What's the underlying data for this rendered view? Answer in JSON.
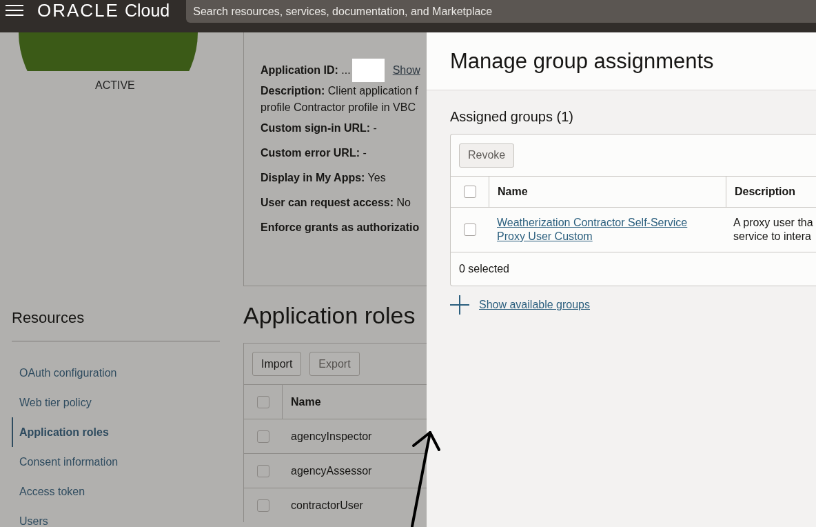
{
  "header": {
    "brand": "ORACLE",
    "product": "Cloud",
    "search_placeholder": "Search resources, services, documentation, and Marketplace"
  },
  "status": {
    "label": "ACTIVE"
  },
  "details": {
    "app_id_label": "Application ID:",
    "app_id_value": "...",
    "show_link": "Show",
    "fields": [
      {
        "text": "**Description:** Client application f\nprofile Contractor profile in VBC"
      },
      {
        "text": "**Custom sign-in URL:** -"
      },
      {
        "text": "**Custom error URL:** -"
      },
      {
        "text": "**Display in My Apps:** Yes"
      },
      {
        "text": "**User can request access:** No"
      },
      {
        "text": "**Enforce grants as authorizatio**"
      }
    ]
  },
  "resources": {
    "title": "Resources",
    "items": [
      {
        "label": "OAuth configuration",
        "selected": false
      },
      {
        "label": "Web tier policy",
        "selected": false
      },
      {
        "label": "Application roles",
        "selected": true
      },
      {
        "label": "Consent information",
        "selected": false
      },
      {
        "label": "Access token",
        "selected": false
      },
      {
        "label": "Users",
        "selected": false
      }
    ]
  },
  "roles": {
    "title": "Application roles",
    "buttons": [
      {
        "label": "Import",
        "disabled": false
      },
      {
        "label": "Export",
        "disabled": true
      }
    ],
    "columns": [
      "Name"
    ],
    "select_all_checked": false,
    "rows": [
      {
        "name": "agencyInspector",
        "checked": false
      },
      {
        "name": "agencyAssessor",
        "checked": false
      },
      {
        "name": "contractorUser",
        "checked": false
      }
    ]
  },
  "panel": {
    "title": "Manage group assignments",
    "section": "Assigned groups (1)",
    "button": {
      "label": "Revoke",
      "disabled": true
    },
    "columns": [
      "Name",
      "Description"
    ],
    "select_all_checked": false,
    "rows": [
      {
        "name": "Weatherization Contractor Self-Service Proxy User Custom",
        "description": "A proxy user tha\nservice to intera",
        "checked": false
      }
    ],
    "footer": "0 selected",
    "add_link": "Show available groups"
  }
}
